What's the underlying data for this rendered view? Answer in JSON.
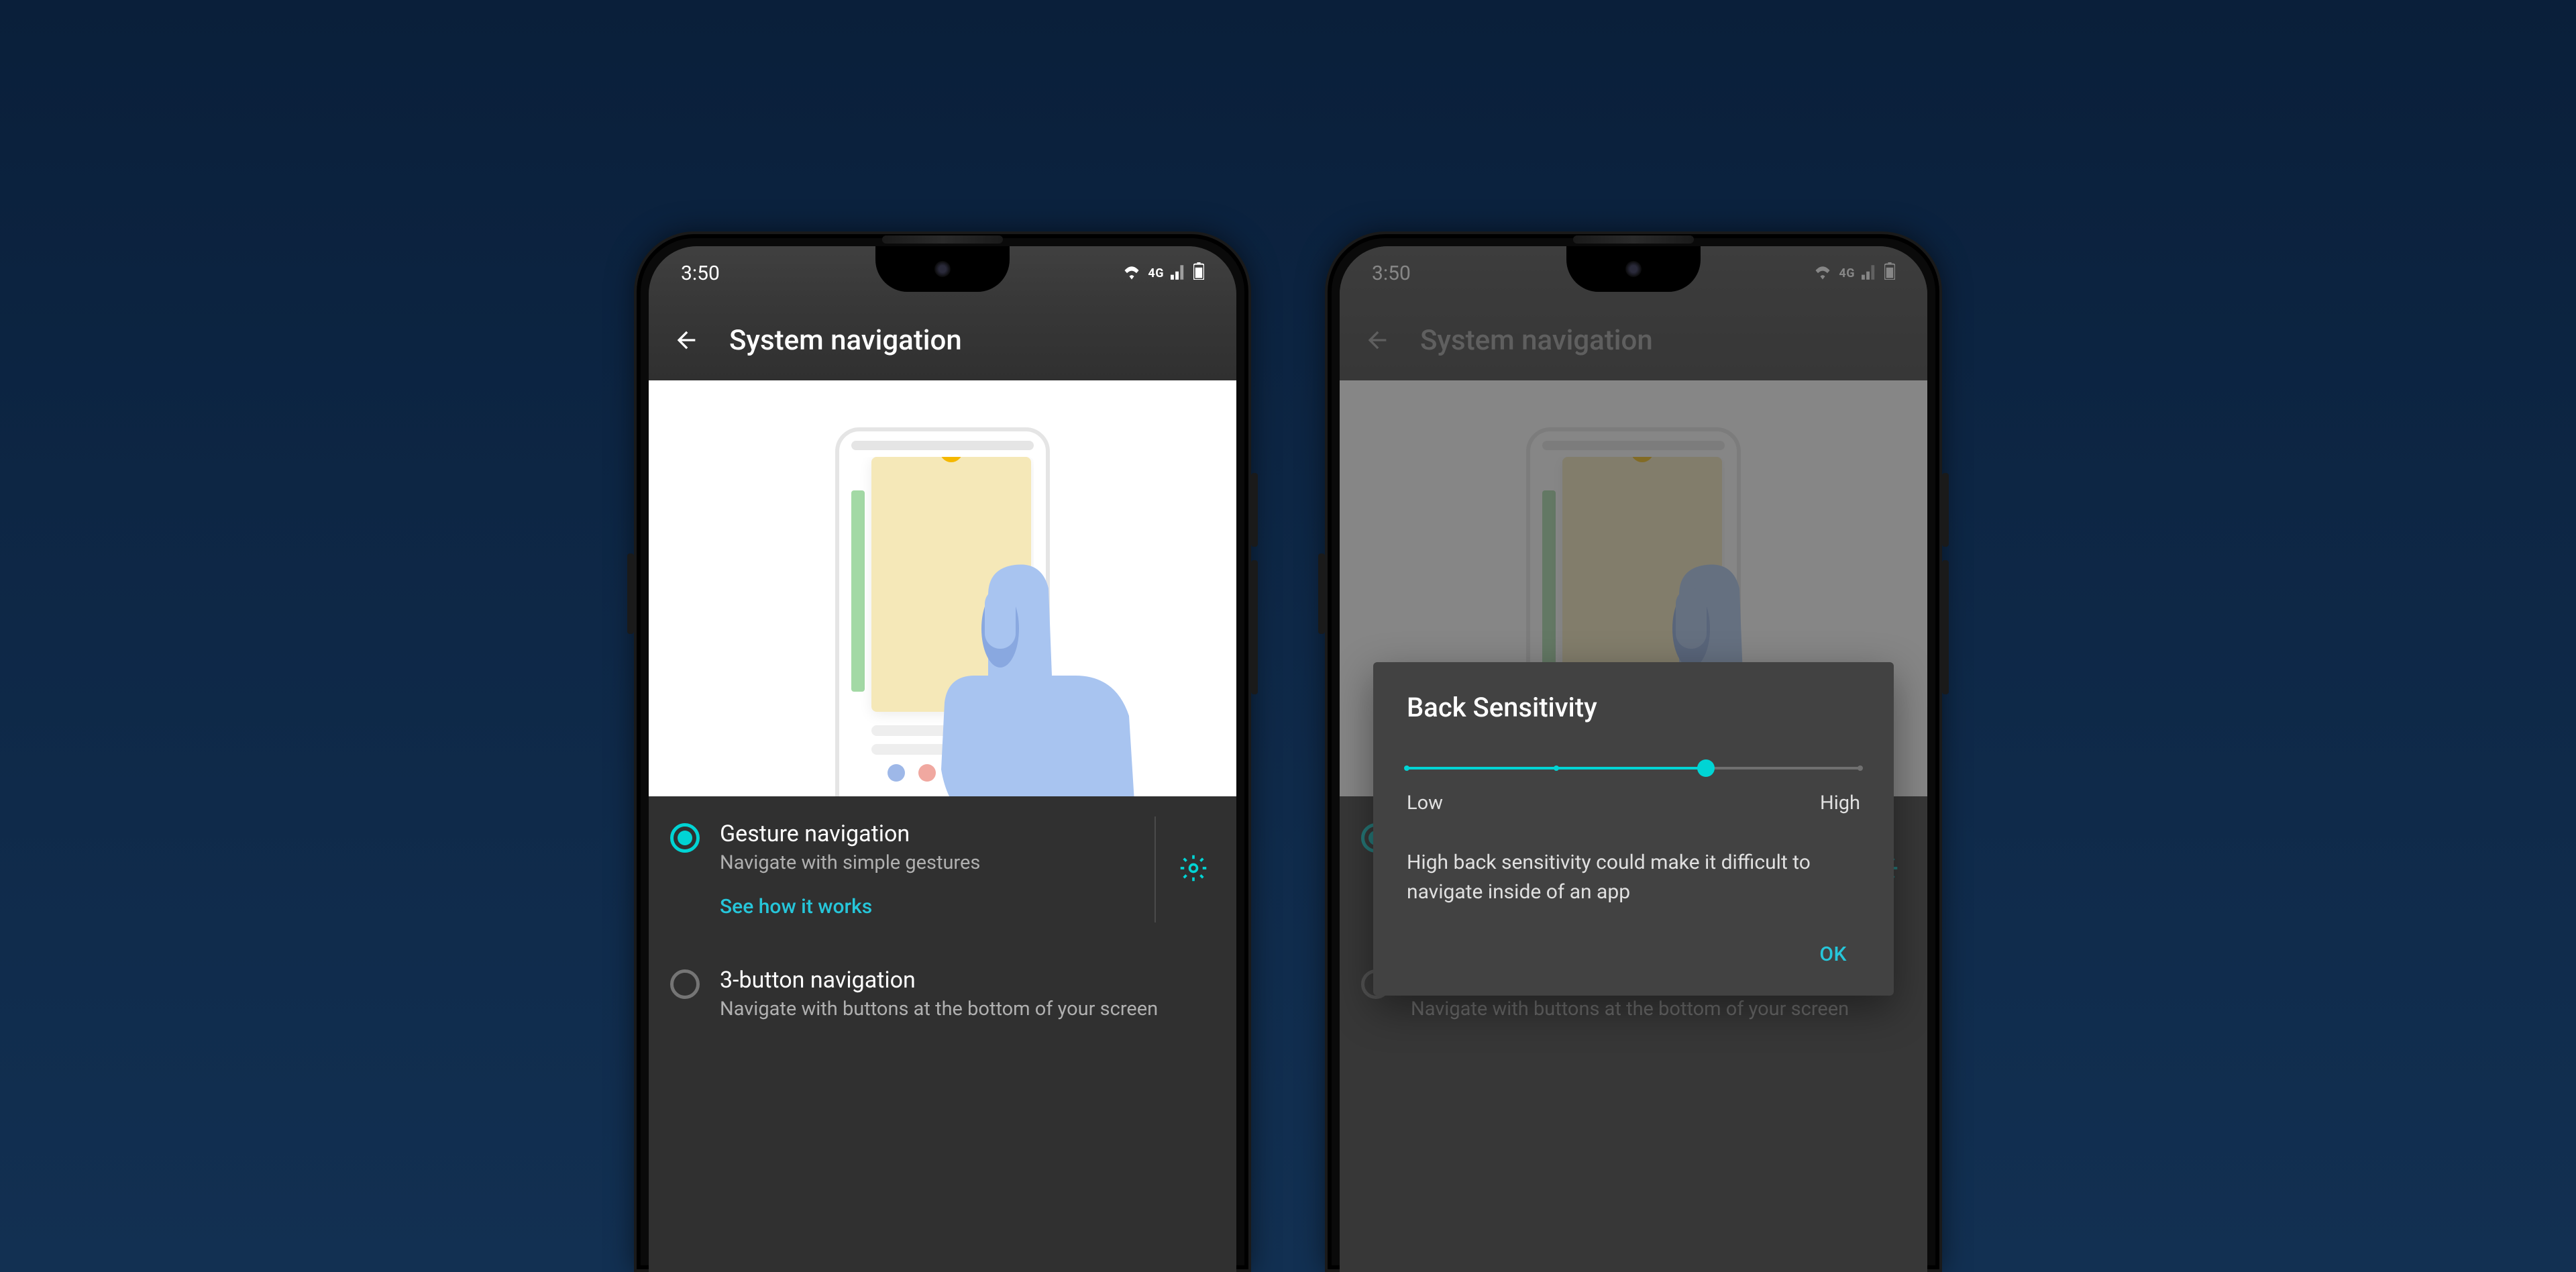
{
  "status": {
    "time": "3:50",
    "network_label": "4G"
  },
  "header": {
    "title": "System navigation"
  },
  "options": {
    "gesture": {
      "title": "Gesture navigation",
      "subtitle": "Navigate with simple gestures",
      "link": "See how it works"
    },
    "three_button": {
      "title": "3-button navigation",
      "subtitle": "Navigate with buttons at the bottom of your screen"
    }
  },
  "dialog": {
    "title": "Back Sensitivity",
    "low_label": "Low",
    "high_label": "High",
    "message": "High back sensitivity could make it difficult to navigate inside of an app",
    "ok": "OK",
    "value_percent": 66
  }
}
